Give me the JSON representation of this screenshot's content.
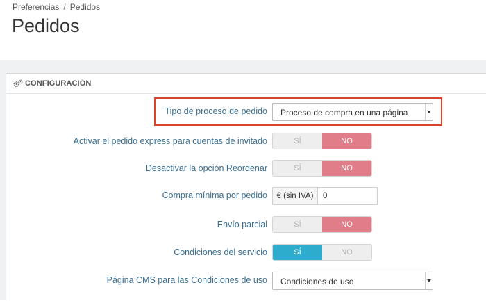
{
  "breadcrumb": {
    "parent": "Preferencias",
    "separator": "/",
    "current": "Pedidos"
  },
  "page_title": "Pedidos",
  "panel": {
    "title": "CONFIGURACIÓN",
    "icon": "gears-icon"
  },
  "fields": {
    "process_type": {
      "label": "Tipo de proceso de pedido",
      "value": "Proceso de compra en una página"
    },
    "guest_express": {
      "label": "Activar el pedido express para cuentas de invitado",
      "yes": "SÍ",
      "no": "NO",
      "selected": "NO"
    },
    "disable_reorder": {
      "label": "Desactivar la opción Reordenar",
      "yes": "SÍ",
      "no": "NO",
      "selected": "NO"
    },
    "min_purchase": {
      "label": "Compra mínima por pedido",
      "addon": "€ (sin IVA)",
      "value": "0"
    },
    "partial_shipping": {
      "label": "Envío parcial",
      "yes": "SÍ",
      "no": "NO",
      "selected": "NO"
    },
    "terms": {
      "label": "Condiciones del servicio",
      "yes": "SÍ",
      "no": "NO",
      "selected": "SÍ"
    },
    "cms_page": {
      "label": "Página CMS para las Condiciones de uso",
      "value": "Condiciones de uso"
    }
  },
  "colors": {
    "label": "#3a6f92",
    "switch_no_active": "#e07d89",
    "switch_yes_active": "#2eacce",
    "highlight": "#d9432c"
  }
}
